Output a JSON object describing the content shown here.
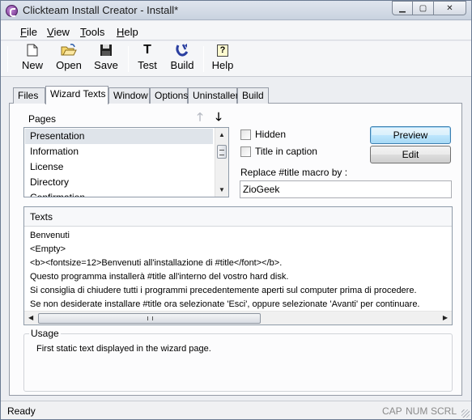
{
  "window": {
    "title": "Clickteam Install Creator - Install*",
    "minimize": "▁",
    "maximize": "▢",
    "close": "✕"
  },
  "menu": {
    "file": "File",
    "view": "View",
    "tools": "Tools",
    "help": "Help"
  },
  "toolbar": {
    "new_label": "New",
    "open_label": "Open",
    "save_label": "Save",
    "test_label": "Test",
    "test_glyph": "T",
    "build_label": "Build",
    "help_label": "Help",
    "help_glyph": "?"
  },
  "tabs": [
    "Files",
    "Wizard Texts",
    "Window",
    "Options",
    "Uninstaller",
    "Build"
  ],
  "active_tab": "Wizard Texts",
  "pages": {
    "label": "Pages",
    "items": [
      "Presentation",
      "Information",
      "License",
      "Directory",
      "Confirmation"
    ],
    "selected": "Presentation"
  },
  "options": {
    "hidden_label": "Hidden",
    "hidden_checked": false,
    "title_caption_label": "Title in caption",
    "title_caption_checked": false,
    "replace_label": "Replace #title macro by :",
    "replace_value": "ZioGeek"
  },
  "buttons": {
    "preview": "Preview",
    "edit": "Edit"
  },
  "texts": {
    "label": "Texts",
    "lines": [
      "Benvenuti",
      "<Empty>",
      "<b><fontsize=12>Benvenuti all'installazione di #title</font></b>.",
      "Questo programma installerà #title all'interno del vostro hard disk.",
      "Si consiglia di chiudere tutti i programmi precedentemente aperti sul computer prima di procedere.",
      "Se non desiderate installare #title ora selezionate 'Esci', oppure selezionate 'Avanti' per continuare."
    ]
  },
  "usage": {
    "label": "Usage",
    "text": "First static text displayed in the wizard page."
  },
  "status": {
    "text": "Ready",
    "cap": "CAP",
    "num": "NUM",
    "scrl": "SCRL"
  }
}
